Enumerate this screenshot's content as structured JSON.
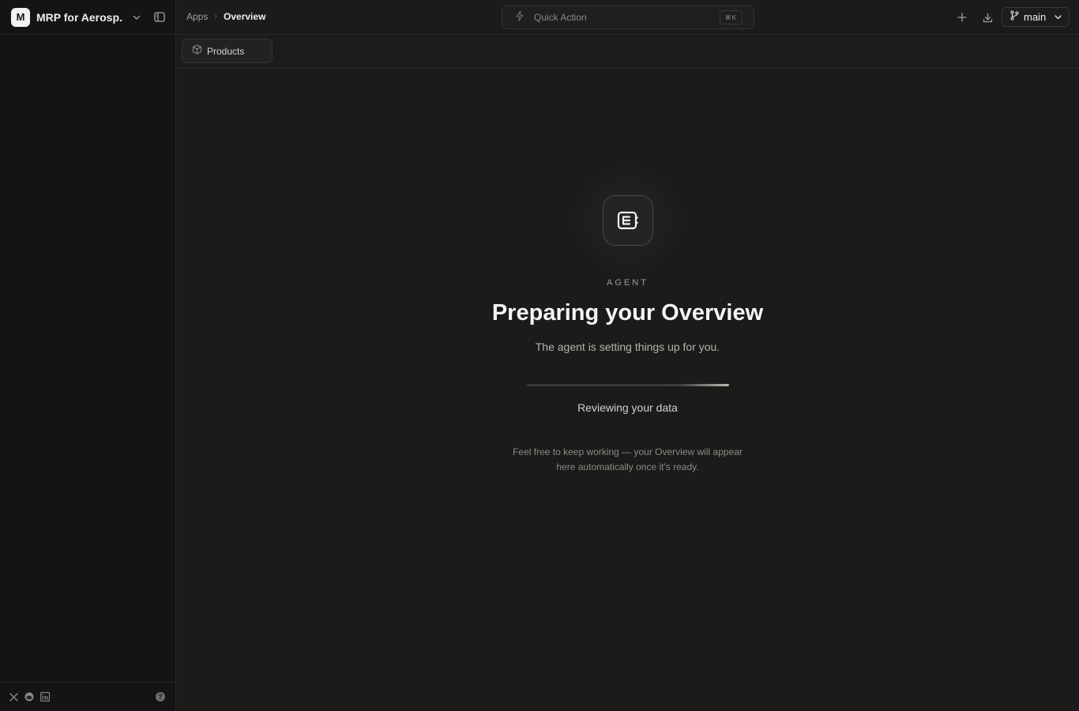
{
  "workspace": {
    "initial": "M",
    "name": "MRP for Aerosp..."
  },
  "breadcrumb": {
    "parent": "Apps",
    "separator": "›",
    "current": "Overview"
  },
  "quick_action": {
    "label": "Quick Action",
    "shortcut": "⌘K"
  },
  "branch": {
    "name": "main"
  },
  "tabs": [
    {
      "label": "Products",
      "icon": "cube-icon"
    }
  ],
  "agent": {
    "eyebrow": "AGENT",
    "title": "Preparing your Overview",
    "subtitle": "The agent is setting things up for you.",
    "progress": 1.0,
    "status": "Reviewing your data",
    "note_line1": "Feel free to keep working — your Overview will appear",
    "note_line2": "here automatically once it's ready."
  },
  "footer": {
    "socials": [
      "x-icon",
      "reddit-icon",
      "linkedin-icon"
    ],
    "help": "?"
  },
  "colors": {
    "background": "#1c1b1a",
    "sidebar": "#151414",
    "accent_text": "#f2f1ef"
  }
}
